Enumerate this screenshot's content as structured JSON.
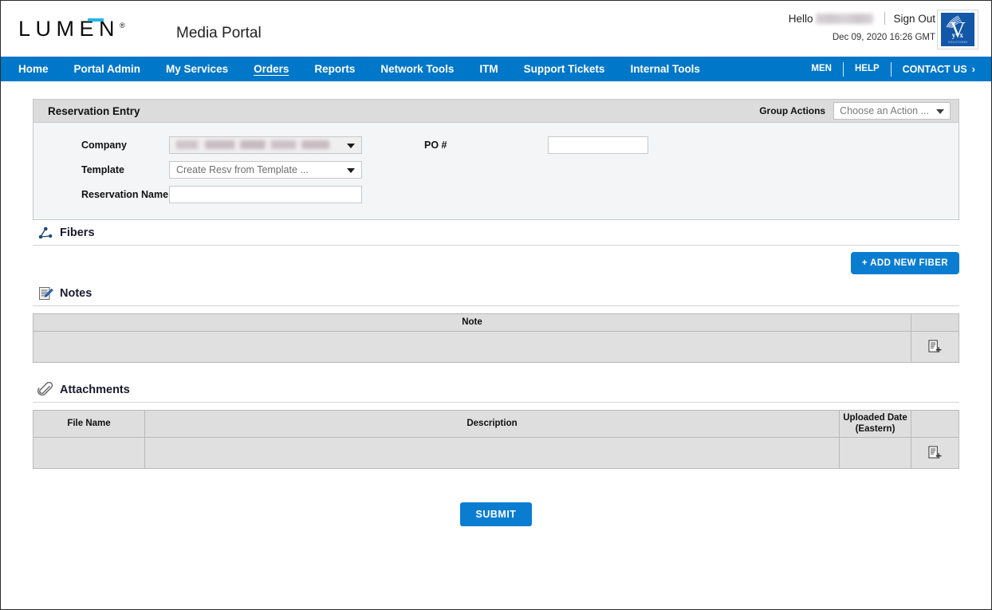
{
  "header": {
    "brand": "LUMEN",
    "brand_registered": "®",
    "app_title": "Media Portal",
    "hello_label": "Hello",
    "user_name": "",
    "sign_out": "Sign Out",
    "datetime": "Dec 09, 2020 16:26 GMT",
    "logo_alt": "Vyvx",
    "vyvx_mark": "V",
    "vyvx_word": "yvx",
    "vyvx_sub": "SOLUTIONS"
  },
  "nav": {
    "items": [
      {
        "label": "Home",
        "active": false
      },
      {
        "label": "Portal Admin",
        "active": false
      },
      {
        "label": "My Services",
        "active": false
      },
      {
        "label": "Orders",
        "active": true
      },
      {
        "label": "Reports",
        "active": false
      },
      {
        "label": "Network Tools",
        "active": false
      },
      {
        "label": "ITM",
        "active": false
      },
      {
        "label": "Support Tickets",
        "active": false
      },
      {
        "label": "Internal Tools",
        "active": false
      }
    ],
    "mini": [
      {
        "label": "MEN"
      },
      {
        "label": "HELP"
      }
    ],
    "contact_us": "CONTACT US",
    "contact_chevron": "›"
  },
  "panel": {
    "title": "Reservation Entry",
    "group_actions_label": "Group Actions",
    "group_actions_value": "Choose an Action ..."
  },
  "form": {
    "company_label": "Company",
    "company_value": "",
    "template_label": "Template",
    "template_value": "Create Resv from Template ...",
    "reservation_name_label": "Reservation Name",
    "reservation_name_value": "",
    "reservation_name_placeholder": "",
    "po_label": "PO #",
    "po_value": "",
    "po_placeholder": ""
  },
  "fibers": {
    "title": "Fibers",
    "icon": "network-nodes-icon",
    "add_button": "+ ADD NEW FIBER"
  },
  "notes": {
    "title": "Notes",
    "icon": "note-edit-icon",
    "columns": [
      "Note",
      ""
    ],
    "rows": [
      {
        "note": "",
        "action_icon": "add-document-icon"
      }
    ]
  },
  "attachments": {
    "title": "Attachments",
    "icon": "paperclip-icon",
    "columns": [
      "File Name",
      "Description",
      "Uploaded Date\n(Eastern)",
      ""
    ],
    "col_file": "File Name",
    "col_desc": "Description",
    "col_date_line1": "Uploaded Date",
    "col_date_line2": "(Eastern)",
    "rows": [
      {
        "file_name": "",
        "description": "",
        "uploaded_date": "",
        "action_icon": "add-document-icon"
      }
    ]
  },
  "footer": {
    "submit_label": "SUBMIT"
  },
  "colors": {
    "nav_blue": "#0077c8",
    "button_blue": "#0b7dd1",
    "accent_cyan": "#25b4e8",
    "panel_header_gray": "#dcdcdd",
    "form_bg": "#f4f5f7",
    "table_header_gray": "#dededf",
    "table_row_gray": "#e0e0e0"
  }
}
